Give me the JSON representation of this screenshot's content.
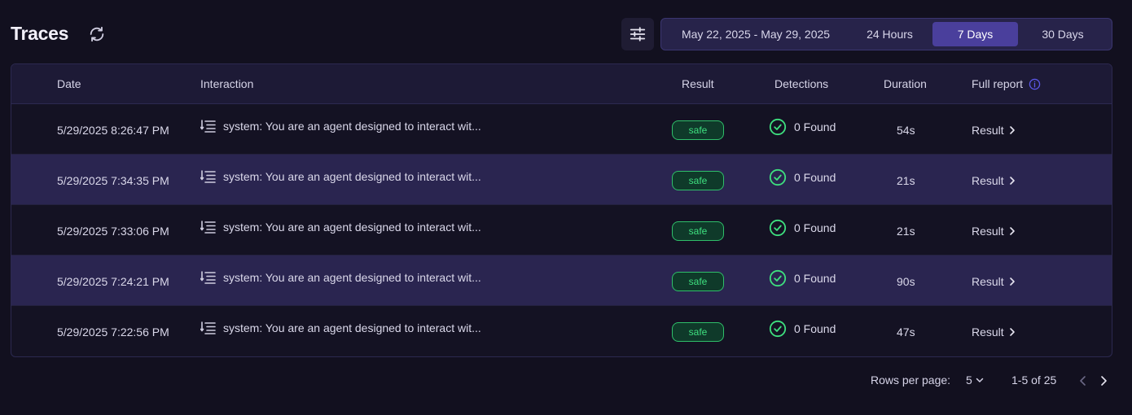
{
  "header": {
    "title": "Traces",
    "date_range": "May 22, 2025 - May 29, 2025",
    "options": [
      "24 Hours",
      "7 Days",
      "30 Days"
    ],
    "selected_option": "7 Days"
  },
  "table": {
    "columns": {
      "date": "Date",
      "interaction": "Interaction",
      "result": "Result",
      "detections": "Detections",
      "duration": "Duration",
      "full_report": "Full report"
    },
    "rows": [
      {
        "date": "5/29/2025 8:26:47 PM",
        "interaction": "system: You are an agent designed to interact wit...",
        "result": "safe",
        "detections": "0 Found",
        "duration": "54s",
        "link": "Result"
      },
      {
        "date": "5/29/2025 7:34:35 PM",
        "interaction": "system: You are an agent designed to interact wit...",
        "result": "safe",
        "detections": "0 Found",
        "duration": "21s",
        "link": "Result"
      },
      {
        "date": "5/29/2025 7:33:06 PM",
        "interaction": "system: You are an agent designed to interact wit...",
        "result": "safe",
        "detections": "0 Found",
        "duration": "21s",
        "link": "Result"
      },
      {
        "date": "5/29/2025 7:24:21 PM",
        "interaction": "system: You are an agent designed to interact wit...",
        "result": "safe",
        "detections": "0 Found",
        "duration": "90s",
        "link": "Result"
      },
      {
        "date": "5/29/2025 7:22:56 PM",
        "interaction": "system: You are an agent designed to interact wit...",
        "result": "safe",
        "detections": "0 Found",
        "duration": "47s",
        "link": "Result"
      }
    ]
  },
  "pagination": {
    "rows_per_page_label": "Rows per page:",
    "rows_per_page": "5",
    "range": "1-5 of 25"
  },
  "colors": {
    "background": "#12101f",
    "accent": "#4a3f9c",
    "safe": "#3ee07f",
    "info": "#5b57e6"
  },
  "icons": {
    "refresh": "refresh-icon",
    "filter": "sliders-icon",
    "interaction": "list-icon",
    "detection": "check-circle-icon",
    "info": "info-icon",
    "link": "chevron-right-icon"
  }
}
